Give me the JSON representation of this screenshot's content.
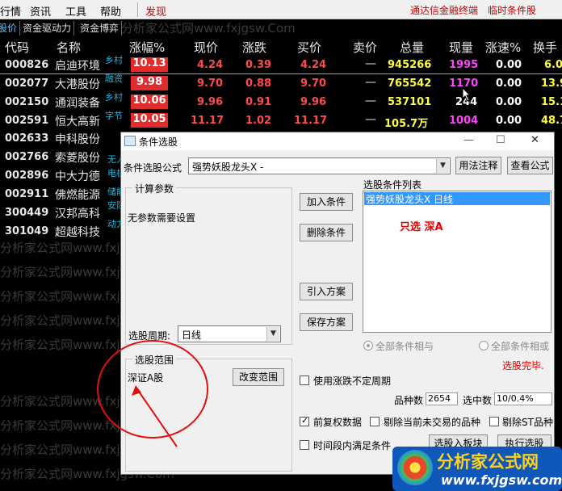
{
  "menubar": {
    "items": [
      "行情",
      "资讯",
      "工具",
      "帮助"
    ],
    "discover": "发现",
    "right_links": [
      "通达信金融终端",
      "临时条件股"
    ]
  },
  "tabs": [
    "股价",
    "资金驱动力",
    "资金博弈"
  ],
  "columns": [
    "代码",
    "名称",
    "涨幅%",
    "现价",
    "涨跌",
    "买价",
    "卖价",
    "总量",
    "现量",
    "涨速%",
    "换手"
  ],
  "rows": [
    {
      "code": "000826",
      "name": "启迪环境",
      "tag": "乡村",
      "pct": "10.13",
      "price": "4.24",
      "chg": "0.39",
      "bid": "4.24",
      "ask": "—",
      "vol": "945266",
      "cur": "1995",
      "speed": "0.00",
      "turn": "6.0"
    },
    {
      "code": "002077",
      "name": "大港股份",
      "tag": "融资",
      "pct": "9.98",
      "price": "9.70",
      "chg": "0.88",
      "bid": "9.70",
      "ask": "—",
      "vol": "765542",
      "cur": "1170",
      "speed": "0.00",
      "turn": "13.9"
    },
    {
      "code": "002150",
      "name": "通润装备",
      "tag": "乡村",
      "pct": "10.06",
      "price": "9.96",
      "chg": "0.91",
      "bid": "9.96",
      "ask": "—",
      "vol": "537101",
      "cur": "244",
      "speed": "0.00",
      "turn": "15.1"
    },
    {
      "code": "002591",
      "name": "恒大高新",
      "tag": "字节",
      "pct": "10.05",
      "price": "11.17",
      "chg": "1.02",
      "bid": "11.17",
      "ask": "—",
      "vol": "105.7万",
      "cur": "1004",
      "speed": "0.00",
      "turn": "48.7"
    },
    {
      "code": "002633",
      "name": "申科股份",
      "tag": "",
      "pct": "",
      "price": "",
      "chg": "",
      "bid": "",
      "ask": "",
      "vol": "",
      "cur": "",
      "speed": "",
      "turn": ""
    },
    {
      "code": "002766",
      "name": "索菱股份",
      "tag": "",
      "pct": "",
      "price": "",
      "chg": "",
      "bid": "",
      "ask": "",
      "vol": "",
      "cur": "",
      "speed": "",
      "turn": ""
    },
    {
      "code": "002896",
      "name": "中大力德",
      "tag": "",
      "pct": "",
      "price": "",
      "chg": "",
      "bid": "",
      "ask": "",
      "vol": "",
      "cur": "",
      "speed": "",
      "turn": ""
    },
    {
      "code": "002911",
      "name": "佛燃能源",
      "tag": "",
      "pct": "",
      "price": "",
      "chg": "",
      "bid": "",
      "ask": "",
      "vol": "",
      "cur": "",
      "speed": "",
      "turn": ""
    },
    {
      "code": "300449",
      "name": "汉邦高科",
      "tag": "",
      "pct": "",
      "price": "",
      "chg": "",
      "bid": "",
      "ask": "",
      "vol": "",
      "cur": "",
      "speed": "",
      "turn": ""
    },
    {
      "code": "301049",
      "name": "超越科技",
      "tag": "",
      "pct": "",
      "price": "",
      "chg": "",
      "bid": "",
      "ask": "",
      "vol": "",
      "cur": "",
      "speed": "",
      "turn": ""
    }
  ],
  "side_tags": [
    "无人",
    "电机",
    "储能",
    "安防",
    "动力"
  ],
  "watermark": "分析家公式网www.fxjgsw.Com",
  "dialog": {
    "title": "条件选股",
    "formula_label": "条件选股公式",
    "formula_value": "强势妖股龙头X  -",
    "usage_btn": "用法注释",
    "view_btn": "查看公式",
    "calc_group": "计算参数",
    "no_param": "无参数需要设置",
    "period_label": "选股周期:",
    "period_value": "日线",
    "range_group": "选股范围",
    "range_value": "深证A股",
    "change_range_btn": "改变范围",
    "add_btn": "加入条件",
    "del_btn": "删除条件",
    "import_btn": "引入方案",
    "save_btn": "保存方案",
    "list_label": "选股条件列表",
    "list_items": [
      "强势妖股龙头X   日线"
    ],
    "note": "只选 深A",
    "and_label": "全部条件相与",
    "or_label": "全部条件相或",
    "done_label": "选股完毕.",
    "uncertain_label": "使用涨跌不定周期",
    "count_label": "品种数",
    "count_value": "2654",
    "selected_label": "选中数",
    "selected_value": "10/0.4%",
    "fq_label": "前复权数据",
    "exclude_label": "剔除当前未交易的品种",
    "st_label": "剔除ST品种",
    "time_label": "时间段内满足条件",
    "to_block_btn": "选股入板块",
    "run_btn": "执行选股"
  },
  "logo": {
    "title": "分析家公式网",
    "url": "www.fxjgsw.com"
  }
}
